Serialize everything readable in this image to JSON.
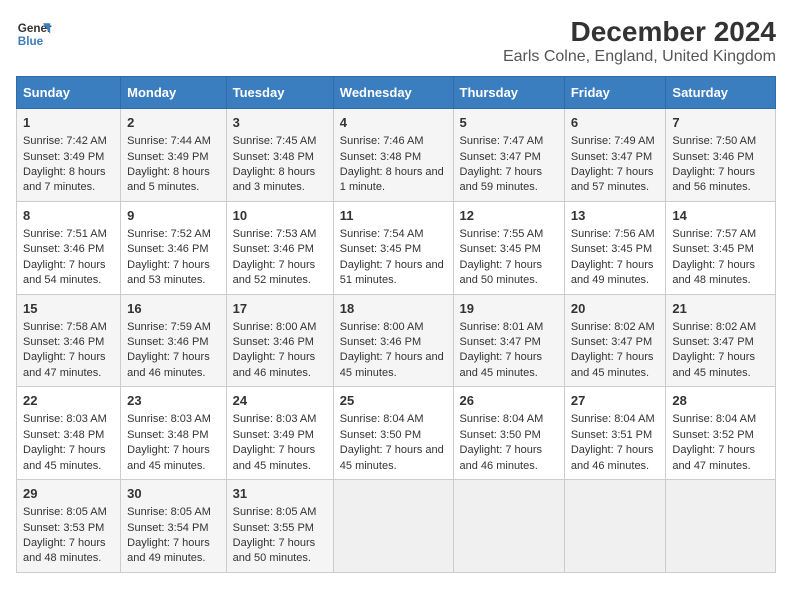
{
  "header": {
    "logo_line1": "General",
    "logo_line2": "Blue",
    "title": "December 2024",
    "subtitle": "Earls Colne, England, United Kingdom"
  },
  "days_of_week": [
    "Sunday",
    "Monday",
    "Tuesday",
    "Wednesday",
    "Thursday",
    "Friday",
    "Saturday"
  ],
  "weeks": [
    [
      {
        "day": "1",
        "sunrise": "Sunrise: 7:42 AM",
        "sunset": "Sunset: 3:49 PM",
        "daylight": "Daylight: 8 hours and 7 minutes."
      },
      {
        "day": "2",
        "sunrise": "Sunrise: 7:44 AM",
        "sunset": "Sunset: 3:49 PM",
        "daylight": "Daylight: 8 hours and 5 minutes."
      },
      {
        "day": "3",
        "sunrise": "Sunrise: 7:45 AM",
        "sunset": "Sunset: 3:48 PM",
        "daylight": "Daylight: 8 hours and 3 minutes."
      },
      {
        "day": "4",
        "sunrise": "Sunrise: 7:46 AM",
        "sunset": "Sunset: 3:48 PM",
        "daylight": "Daylight: 8 hours and 1 minute."
      },
      {
        "day": "5",
        "sunrise": "Sunrise: 7:47 AM",
        "sunset": "Sunset: 3:47 PM",
        "daylight": "Daylight: 7 hours and 59 minutes."
      },
      {
        "day": "6",
        "sunrise": "Sunrise: 7:49 AM",
        "sunset": "Sunset: 3:47 PM",
        "daylight": "Daylight: 7 hours and 57 minutes."
      },
      {
        "day": "7",
        "sunrise": "Sunrise: 7:50 AM",
        "sunset": "Sunset: 3:46 PM",
        "daylight": "Daylight: 7 hours and 56 minutes."
      }
    ],
    [
      {
        "day": "8",
        "sunrise": "Sunrise: 7:51 AM",
        "sunset": "Sunset: 3:46 PM",
        "daylight": "Daylight: 7 hours and 54 minutes."
      },
      {
        "day": "9",
        "sunrise": "Sunrise: 7:52 AM",
        "sunset": "Sunset: 3:46 PM",
        "daylight": "Daylight: 7 hours and 53 minutes."
      },
      {
        "day": "10",
        "sunrise": "Sunrise: 7:53 AM",
        "sunset": "Sunset: 3:46 PM",
        "daylight": "Daylight: 7 hours and 52 minutes."
      },
      {
        "day": "11",
        "sunrise": "Sunrise: 7:54 AM",
        "sunset": "Sunset: 3:45 PM",
        "daylight": "Daylight: 7 hours and 51 minutes."
      },
      {
        "day": "12",
        "sunrise": "Sunrise: 7:55 AM",
        "sunset": "Sunset: 3:45 PM",
        "daylight": "Daylight: 7 hours and 50 minutes."
      },
      {
        "day": "13",
        "sunrise": "Sunrise: 7:56 AM",
        "sunset": "Sunset: 3:45 PM",
        "daylight": "Daylight: 7 hours and 49 minutes."
      },
      {
        "day": "14",
        "sunrise": "Sunrise: 7:57 AM",
        "sunset": "Sunset: 3:45 PM",
        "daylight": "Daylight: 7 hours and 48 minutes."
      }
    ],
    [
      {
        "day": "15",
        "sunrise": "Sunrise: 7:58 AM",
        "sunset": "Sunset: 3:46 PM",
        "daylight": "Daylight: 7 hours and 47 minutes."
      },
      {
        "day": "16",
        "sunrise": "Sunrise: 7:59 AM",
        "sunset": "Sunset: 3:46 PM",
        "daylight": "Daylight: 7 hours and 46 minutes."
      },
      {
        "day": "17",
        "sunrise": "Sunrise: 8:00 AM",
        "sunset": "Sunset: 3:46 PM",
        "daylight": "Daylight: 7 hours and 46 minutes."
      },
      {
        "day": "18",
        "sunrise": "Sunrise: 8:00 AM",
        "sunset": "Sunset: 3:46 PM",
        "daylight": "Daylight: 7 hours and 45 minutes."
      },
      {
        "day": "19",
        "sunrise": "Sunrise: 8:01 AM",
        "sunset": "Sunset: 3:47 PM",
        "daylight": "Daylight: 7 hours and 45 minutes."
      },
      {
        "day": "20",
        "sunrise": "Sunrise: 8:02 AM",
        "sunset": "Sunset: 3:47 PM",
        "daylight": "Daylight: 7 hours and 45 minutes."
      },
      {
        "day": "21",
        "sunrise": "Sunrise: 8:02 AM",
        "sunset": "Sunset: 3:47 PM",
        "daylight": "Daylight: 7 hours and 45 minutes."
      }
    ],
    [
      {
        "day": "22",
        "sunrise": "Sunrise: 8:03 AM",
        "sunset": "Sunset: 3:48 PM",
        "daylight": "Daylight: 7 hours and 45 minutes."
      },
      {
        "day": "23",
        "sunrise": "Sunrise: 8:03 AM",
        "sunset": "Sunset: 3:48 PM",
        "daylight": "Daylight: 7 hours and 45 minutes."
      },
      {
        "day": "24",
        "sunrise": "Sunrise: 8:03 AM",
        "sunset": "Sunset: 3:49 PM",
        "daylight": "Daylight: 7 hours and 45 minutes."
      },
      {
        "day": "25",
        "sunrise": "Sunrise: 8:04 AM",
        "sunset": "Sunset: 3:50 PM",
        "daylight": "Daylight: 7 hours and 45 minutes."
      },
      {
        "day": "26",
        "sunrise": "Sunrise: 8:04 AM",
        "sunset": "Sunset: 3:50 PM",
        "daylight": "Daylight: 7 hours and 46 minutes."
      },
      {
        "day": "27",
        "sunrise": "Sunrise: 8:04 AM",
        "sunset": "Sunset: 3:51 PM",
        "daylight": "Daylight: 7 hours and 46 minutes."
      },
      {
        "day": "28",
        "sunrise": "Sunrise: 8:04 AM",
        "sunset": "Sunset: 3:52 PM",
        "daylight": "Daylight: 7 hours and 47 minutes."
      }
    ],
    [
      {
        "day": "29",
        "sunrise": "Sunrise: 8:05 AM",
        "sunset": "Sunset: 3:53 PM",
        "daylight": "Daylight: 7 hours and 48 minutes."
      },
      {
        "day": "30",
        "sunrise": "Sunrise: 8:05 AM",
        "sunset": "Sunset: 3:54 PM",
        "daylight": "Daylight: 7 hours and 49 minutes."
      },
      {
        "day": "31",
        "sunrise": "Sunrise: 8:05 AM",
        "sunset": "Sunset: 3:55 PM",
        "daylight": "Daylight: 7 hours and 50 minutes."
      },
      null,
      null,
      null,
      null
    ]
  ]
}
